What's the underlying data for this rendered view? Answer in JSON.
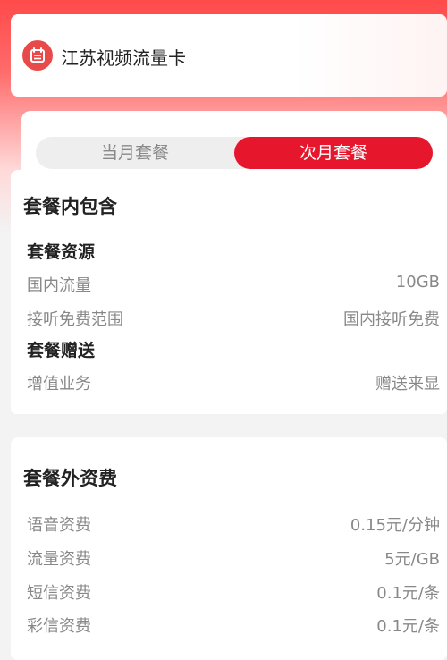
{
  "header": {
    "title": "江苏视频流量卡",
    "icon": "calendar-icon",
    "accent": "#e84a4a"
  },
  "tabs": [
    {
      "label": "当月套餐",
      "selected": false
    },
    {
      "label": "次月套餐",
      "selected": true
    }
  ],
  "included": {
    "title": "套餐内包含",
    "resources_title": "套餐资源",
    "resources": [
      {
        "label": "国内流量",
        "value": "10GB"
      },
      {
        "label": "接听免费范围",
        "value": "国内接听免费"
      }
    ],
    "gifts_title": "套餐赠送",
    "gifts": [
      {
        "label": "增值业务",
        "value": "赠送来显"
      }
    ]
  },
  "excluded": {
    "title": "套餐外资费",
    "rows": [
      {
        "label": "语音资费",
        "value": "0.15元/分钟"
      },
      {
        "label": "流量资费",
        "value": "5元/GB"
      },
      {
        "label": "短信资费",
        "value": "0.1元/条"
      },
      {
        "label": "彩信资费",
        "value": "0.1元/条"
      }
    ]
  },
  "colors": {
    "brand_red": "#e6162d",
    "muted_text": "#888888"
  }
}
